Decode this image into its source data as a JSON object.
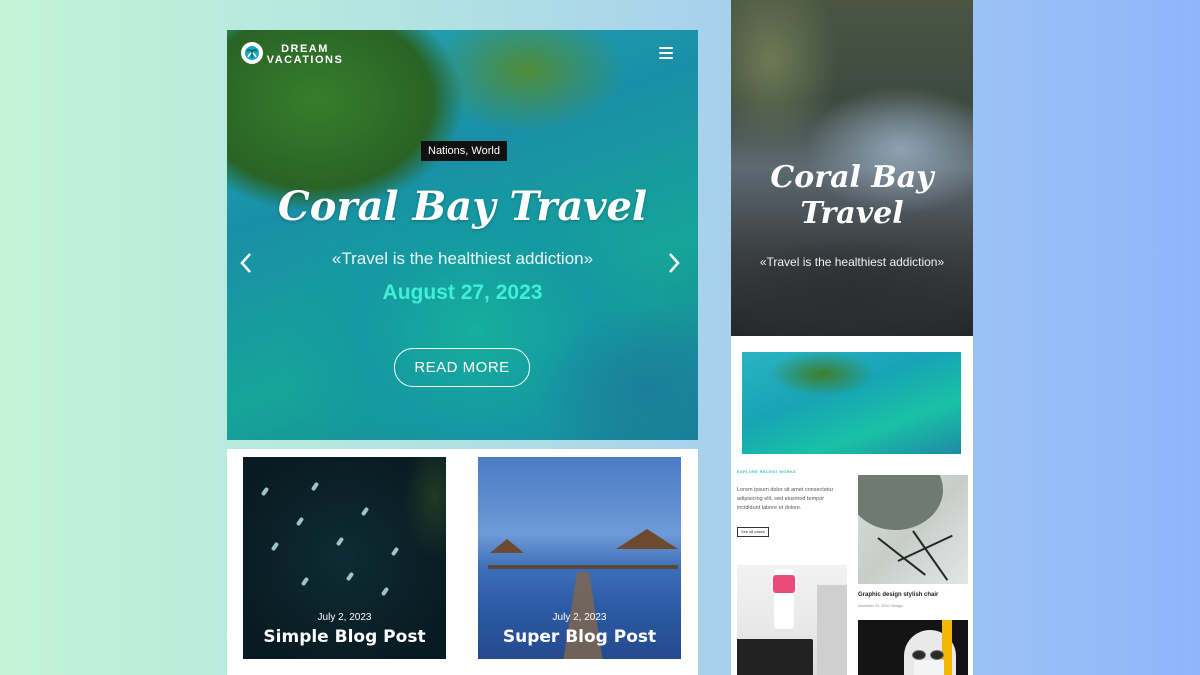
{
  "left_mockup": {
    "logo": {
      "line1": "DREAM",
      "line2": "VACATIONS",
      "icon": "globe-palm-icon"
    },
    "menu_icon": "hamburger-menu-icon",
    "hero": {
      "category": "Nations, World",
      "title": "Coral Bay Travel",
      "quote": "«Travel is the healthiest addiction»",
      "date": "August 27, 2023",
      "cta": "READ MORE",
      "prev_icon": "chevron-left-icon",
      "next_icon": "chevron-right-icon",
      "date_color": "#3ff0d8"
    },
    "posts": [
      {
        "date": "July 2, 2023",
        "title": "Simple Blog Post"
      },
      {
        "date": "July 2, 2023",
        "title": "Super Blog Post"
      }
    ]
  },
  "right_mockup": {
    "hero": {
      "title": "Coral Bay Travel",
      "quote": "«Travel is the healthiest addiction»"
    },
    "section_label": "EXPLORE RECENT WORKS",
    "body_text": "Lorem ipsum dolor sit amet consectetur adipisicing elit, sed eiusmod tempor incididunt labore et dolore.",
    "see_all_button": "See all cases",
    "chair_card": {
      "title": "Graphic design stylish chair",
      "meta": "November 29, 2024 / Design"
    },
    "accent_color": "#3fc9b4"
  }
}
